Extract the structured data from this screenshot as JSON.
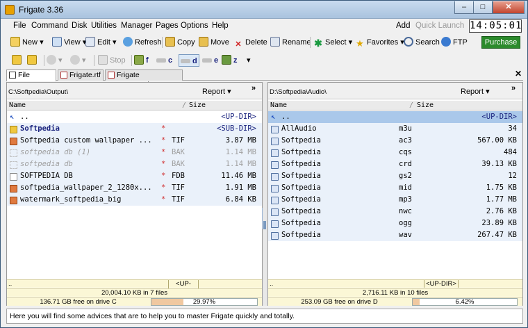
{
  "window": {
    "title": "Frigate 3.36",
    "min": "–",
    "max": "□",
    "close": "✕"
  },
  "menu": [
    "File",
    "Command",
    "Disk",
    "Utilities",
    "Manager",
    "Pages",
    "Options",
    "Help"
  ],
  "menu_right": {
    "add": "Add",
    "quick_launch": "Quick Launch",
    "clock": "14:05:01"
  },
  "toolbar1": {
    "new": "New",
    "view": "View",
    "edit": "Edit",
    "refresh": "Refresh",
    "copy": "Copy",
    "move": "Move",
    "delete": "Delete",
    "rename": "Rename",
    "select": "Select",
    "favorites": "Favorites",
    "search": "Search",
    "ftp": "FTP",
    "purchase": "Purchase"
  },
  "toolbar2": {
    "stop": "Stop",
    "drives": [
      "f",
      "c",
      "d",
      "e",
      "z"
    ]
  },
  "tabs": [
    "File Manager",
    "Frigate.rtf",
    "Frigate Features.htm"
  ],
  "left": {
    "path": "C:\\Softpedia\\Output\\",
    "report": "Report",
    "col_name": "Name",
    "col_size": "Size",
    "rows": [
      {
        "name": "..",
        "ext": "",
        "size": "<UP-DIR>",
        "type": "up"
      },
      {
        "name": "Softpedia",
        "ext": "",
        "size": "<SUB-DIR>",
        "type": "dir",
        "mark": "*"
      },
      {
        "name": "Softpedia custom wallpaper ...",
        "ext": "TIF",
        "size": "3.87 MB",
        "type": "img",
        "mark": "*"
      },
      {
        "name": "softpedia db (1)",
        "ext": "BAK",
        "size": "1.14 MB",
        "type": "ghost",
        "mark": "*"
      },
      {
        "name": "softpedia db",
        "ext": "BAK",
        "size": "1.14 MB",
        "type": "ghost",
        "mark": "*"
      },
      {
        "name": "SOFTPEDIA DB",
        "ext": "FDB",
        "size": "11.46 MB",
        "type": "file",
        "mark": "*"
      },
      {
        "name": "softpedia_wallpaper_2_1280x...",
        "ext": "TIF",
        "size": "1.91 MB",
        "type": "img",
        "mark": "*"
      },
      {
        "name": "watermark_softpedia_big",
        "ext": "TIF",
        "size": "6.84 KB",
        "type": "img",
        "mark": "*"
      }
    ],
    "sel_label": "..",
    "sel_dir": "<UP-DIR>",
    "summary": "20,004.10 KB in 7 files",
    "free": "136.71 GB free on drive C",
    "pct": "29.97%",
    "pct_value": 29.97
  },
  "right": {
    "path": "D:\\Softpedia\\Audio\\",
    "report": "Report",
    "col_name": "Name",
    "col_size": "Size",
    "rows": [
      {
        "name": "..",
        "ext": "",
        "size": "<UP-DIR>",
        "type": "up"
      },
      {
        "name": "AllAudio",
        "ext": "m3u",
        "size": "34",
        "type": "audio"
      },
      {
        "name": "Softpedia",
        "ext": "ac3",
        "size": "567.00 KB",
        "type": "audio"
      },
      {
        "name": "Softpedia",
        "ext": "cqs",
        "size": "484",
        "type": "audio"
      },
      {
        "name": "Softpedia",
        "ext": "crd",
        "size": "39.13 KB",
        "type": "audio"
      },
      {
        "name": "Softpedia",
        "ext": "gs2",
        "size": "12",
        "type": "audio"
      },
      {
        "name": "Softpedia",
        "ext": "mid",
        "size": "1.75 KB",
        "type": "audio"
      },
      {
        "name": "Softpedia",
        "ext": "mp3",
        "size": "1.77 MB",
        "type": "audio"
      },
      {
        "name": "Softpedia",
        "ext": "nwc",
        "size": "2.76 KB",
        "type": "audio"
      },
      {
        "name": "Softpedia",
        "ext": "ogg",
        "size": "23.89 KB",
        "type": "audio"
      },
      {
        "name": "Softpedia",
        "ext": "wav",
        "size": "267.47 KB",
        "type": "audio"
      }
    ],
    "sel_label": "..",
    "sel_dir": "<UP-DIR>",
    "summary": "2,716.11 KB in 10 files",
    "free": "253.09 GB free on drive D",
    "pct": "6.42%",
    "pct_value": 6.42
  },
  "status": "Here you will find some advices that are to help you to master Frigate quickly and totally.",
  "colors": {
    "selected_row": "#aac8ea",
    "dir_text": "#1a237e",
    "ghost_text": "#a0a0a0",
    "accent": "#2c8a2c"
  }
}
